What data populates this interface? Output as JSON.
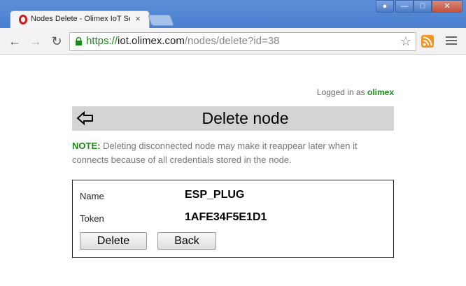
{
  "browser": {
    "tab_title": "Nodes Delete - Olimex IoT Se",
    "tab_close": "×",
    "url": {
      "scheme": "https://",
      "host": "iot.olimex.com",
      "path": "/nodes/delete?id=38"
    }
  },
  "session": {
    "logged_in_label": "Logged in as",
    "username": "olimex"
  },
  "header": {
    "title": "Delete node"
  },
  "note": {
    "label": "NOTE:",
    "text": "Deleting disconnected node may make it reappear later when it connects because of all credentials stored in the node."
  },
  "node": {
    "name_label": "Name",
    "name_value": "ESP_PLUG",
    "token_label": "Token",
    "token_value": "1AFE34F5E1D1"
  },
  "actions": {
    "delete_label": "Delete",
    "back_label": "Back"
  },
  "colors": {
    "accent_green": "#1a8a1a",
    "header_bar": "#d4d4d4",
    "chrome_blue": "#4a7fd0"
  }
}
